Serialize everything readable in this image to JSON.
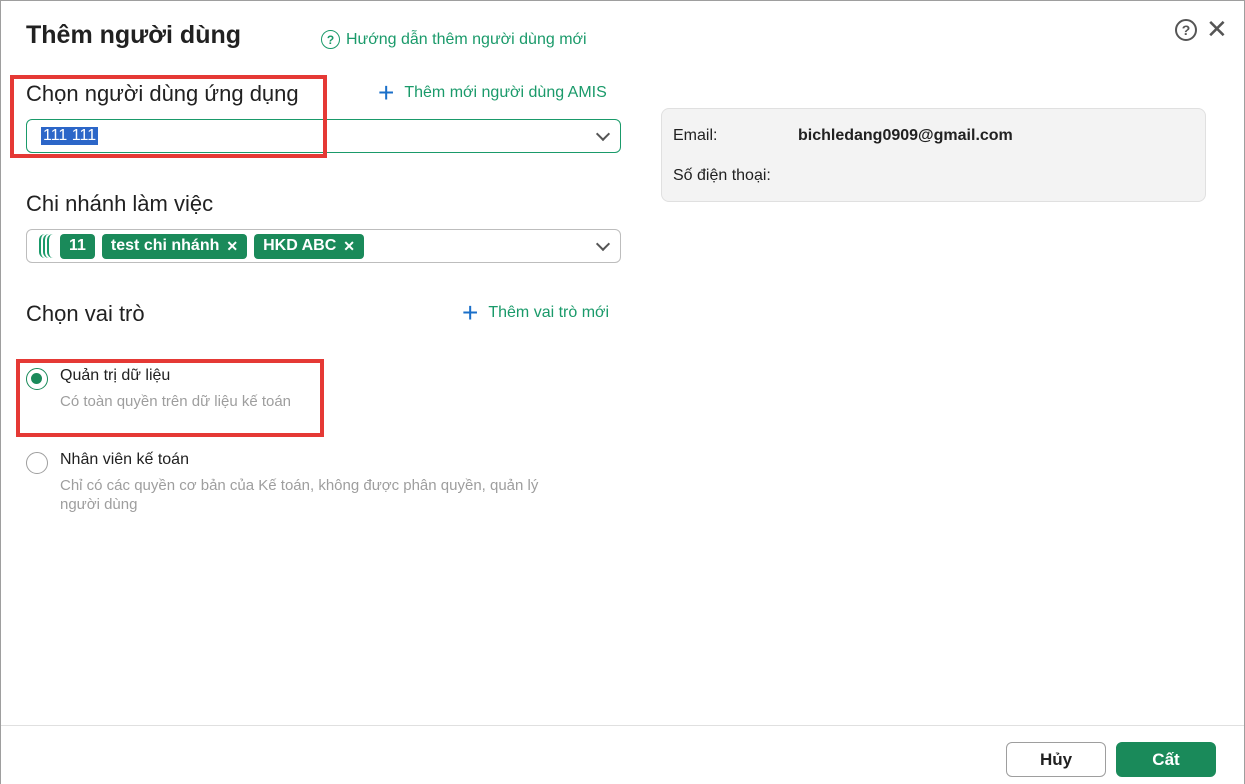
{
  "dialog": {
    "title": "Thêm người dùng",
    "guide_link": "Hướng dẫn thêm người dùng mới",
    "help_glyph": "?",
    "close_glyph": "✕"
  },
  "app_user": {
    "label": "Chọn người dùng ứng dụng",
    "add_link": "Thêm mới người dùng AMIS",
    "selected_value": "111 111"
  },
  "branch": {
    "label": "Chi nhánh làm việc",
    "chips": [
      "11",
      "test chi nhánh",
      "HKD ABC"
    ]
  },
  "role": {
    "label": "Chọn vai trò",
    "add_link": "Thêm vai trò mới",
    "options": [
      {
        "title": "Quản trị dữ liệu",
        "desc": "Có toàn quyền trên dữ liệu kế toán",
        "checked": true
      },
      {
        "title": "Nhân viên kế toán",
        "desc": "Chỉ có các quyền cơ bản của Kế toán, không được phân quyền, quản lý người dùng",
        "checked": false
      }
    ]
  },
  "info": {
    "email_label": "Email:",
    "email_value": "bichledang0909@gmail.com",
    "phone_label": "Số điện thoại:",
    "phone_value": ""
  },
  "footer": {
    "cancel_label": "Hủy",
    "save_label": "Cất"
  },
  "colors": {
    "accent": "#1a8a5a",
    "link": "#1a9a6a",
    "plus_icon": "#1a6fc9",
    "highlight_box": "#e53935",
    "selection": "#2c66c8"
  }
}
